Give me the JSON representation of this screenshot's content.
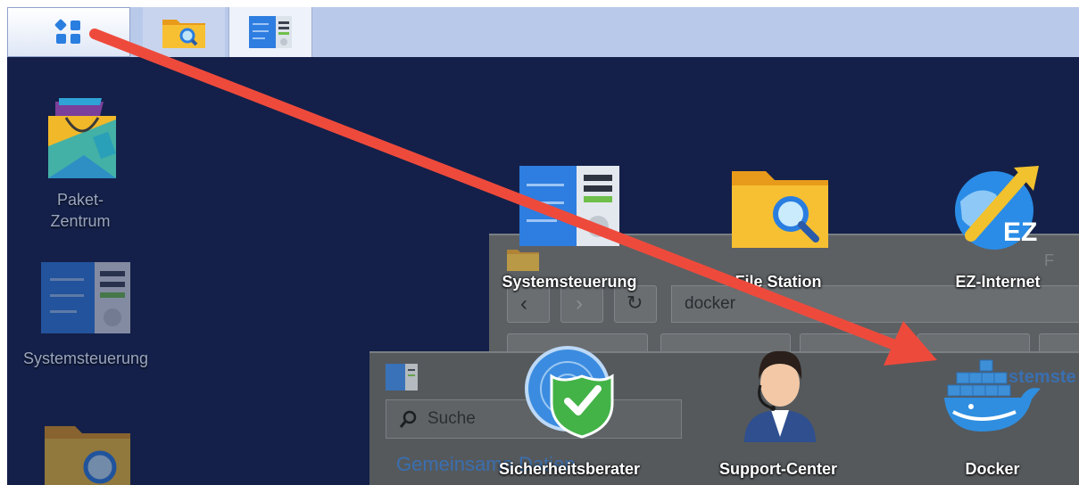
{
  "taskbar": {
    "buttons": [
      {
        "icon": "main-menu-icon"
      },
      {
        "icon": "file-station-icon"
      },
      {
        "icon": "control-panel-icon"
      }
    ]
  },
  "desktop": {
    "shortcuts": [
      {
        "label_line1": "Paket-",
        "label_line2": "Zentrum",
        "icon": "package-center-icon"
      },
      {
        "label": "Systemsteuerung",
        "icon": "control-panel-icon"
      },
      {
        "icon": "file-station-icon"
      }
    ]
  },
  "bg_window_file_station": {
    "search_value": "docker",
    "corner_text": "F"
  },
  "bg_window_control_panel": {
    "search_placeholder": "Suche",
    "section_title": "Gemeinsame Datien",
    "title_fragment": "stemste"
  },
  "main_menu": {
    "items": [
      {
        "label": "Systemsteuerung",
        "icon": "control-panel-icon"
      },
      {
        "label": "File Station",
        "icon": "file-station-icon"
      },
      {
        "label": "EZ-Internet",
        "icon": "ez-internet-icon"
      },
      {
        "label": "Sicherheitsberater",
        "icon": "security-advisor-icon"
      },
      {
        "label": "Support-Center",
        "icon": "support-center-icon"
      },
      {
        "label": "Docker",
        "icon": "docker-icon"
      }
    ]
  },
  "colors": {
    "desktop_bg": "#142049",
    "taskbar_bg": "#b9c9ea",
    "arrow": "#ee4a3c",
    "folder": "#f4b22a",
    "accent_blue": "#2a7ee0"
  }
}
